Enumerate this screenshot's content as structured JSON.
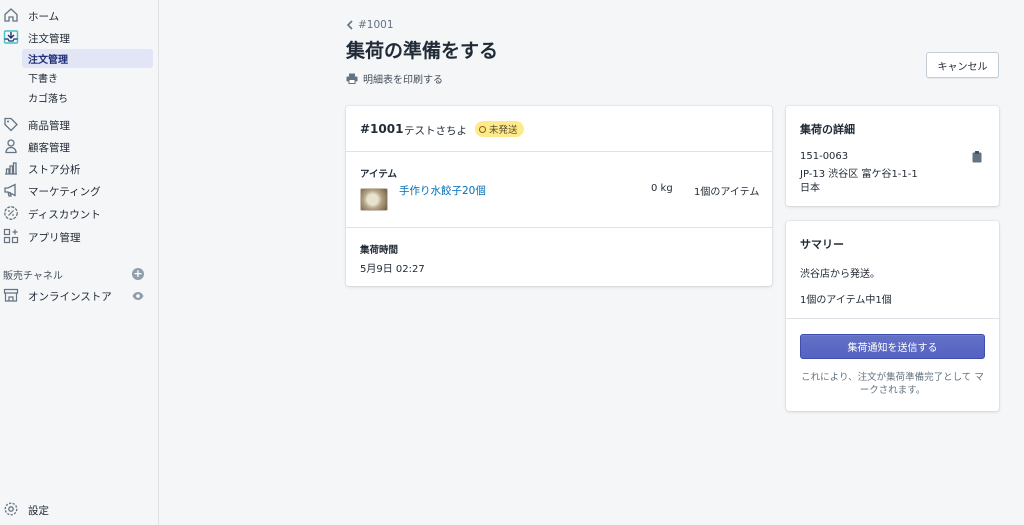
{
  "sidebar": {
    "items": [
      {
        "label": "ホーム",
        "icon": "home-icon"
      },
      {
        "label": "注文管理",
        "icon": "orders-icon"
      },
      {
        "label": "商品管理",
        "icon": "tag-icon"
      },
      {
        "label": "顧客管理",
        "icon": "person-icon"
      },
      {
        "label": "ストア分析",
        "icon": "bar-chart-icon"
      },
      {
        "label": "マーケティング",
        "icon": "megaphone-icon"
      },
      {
        "label": "ディスカウント",
        "icon": "discount-icon"
      },
      {
        "label": "アプリ管理",
        "icon": "apps-icon"
      }
    ],
    "sub_items": [
      {
        "label": "注文管理",
        "active": true
      },
      {
        "label": "下書き",
        "active": false
      },
      {
        "label": "カゴ落ち",
        "active": false
      }
    ],
    "channels_header": "販売チャネル",
    "online_store": "オンラインストア",
    "settings": "設定"
  },
  "header": {
    "back_label": "#1001",
    "title": "集荷の準備をする",
    "print_label": "明細表を印刷する",
    "cancel_label": "キャンセル"
  },
  "order": {
    "number": "#1001",
    "customer": "テストさちよ",
    "status": "未発送",
    "items_heading": "アイテム",
    "item_name": "手作り水餃子20個",
    "item_weight": "0 kg",
    "item_qty": "1個のアイテム",
    "pickup_heading": "集荷時間",
    "pickup_time": "5月9日 02:27"
  },
  "pickup_details": {
    "heading": "集荷の詳細",
    "postal": "151-0063",
    "address": "JP-13 渋谷区 富ケ谷1-1-1",
    "country": "日本"
  },
  "summary": {
    "heading": "サマリー",
    "ship_from": "渋谷店から発送。",
    "count": "1個のアイテム中1個",
    "button_label": "集荷通知を送信する",
    "note": "これにより、注文が集荷準備完了として マークされます。"
  },
  "colors": {
    "primary": "#5c6ac4",
    "link": "#006fbb",
    "badge_bg": "#ffea8a",
    "active_bg": "#e1e5f5"
  }
}
